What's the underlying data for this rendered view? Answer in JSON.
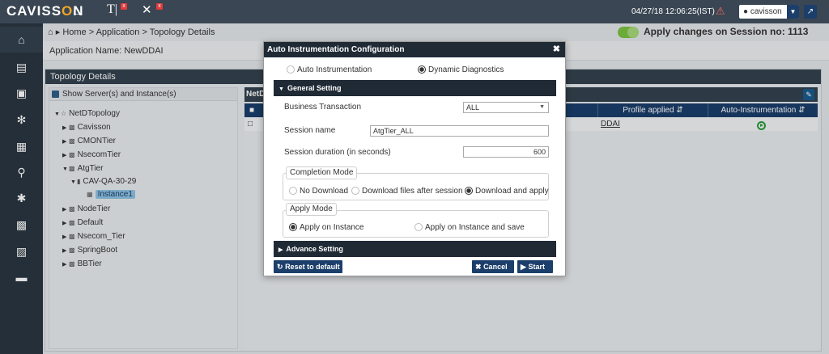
{
  "topbar": {
    "logo_left": "CAVISS",
    "logo_accent": "O",
    "logo_right": "N",
    "datetime": "04/27/18 12:06:25(IST)",
    "user": "cavisson",
    "colors": {
      "bar": "#3a4653",
      "accent": "#f5a623",
      "button": "#1b3e6b"
    }
  },
  "breadcrumb": {
    "text": "Home > Application > Topology Details"
  },
  "apply_changes": {
    "label": "Apply changes on Session no: 1113"
  },
  "app_name": "Application Name: NewDDAI",
  "topology": {
    "header": "Topology Details",
    "show_label": "Show Server(s) and Instance(s)",
    "tree": [
      {
        "label": "NetDTopology"
      },
      {
        "label": "Cavisson"
      },
      {
        "label": "CMONTier"
      },
      {
        "label": "NsecomTier"
      },
      {
        "label": "AtgTier"
      },
      {
        "label": "CAV-QA-30-29"
      },
      {
        "label": "Instance1"
      },
      {
        "label": "NodeTier"
      },
      {
        "label": "Default"
      },
      {
        "label": "Nsecom_Tier"
      },
      {
        "label": "SpringBoot"
      },
      {
        "label": "BBTier"
      }
    ]
  },
  "grid": {
    "title": "NetDT",
    "columns": {
      "profile": "Profile applied",
      "auto": "Auto-Instrumentation"
    },
    "row": {
      "profile": "DDAI"
    }
  },
  "modal": {
    "title": "Auto Instrumentation Configuration",
    "mode_options": [
      "Auto Instrumentation",
      "Dynamic Diagnostics"
    ],
    "general_setting": "General Setting",
    "business_transaction_label": "Business Transaction",
    "business_transaction_value": "ALL",
    "session_name_label": "Session name",
    "session_name_value": "AtgTier_ALL",
    "session_duration_label": "Session duration (in seconds)",
    "session_duration_value": "600",
    "completion_mode": {
      "legend": "Completion Mode",
      "options": [
        "No Download",
        "Download files after session",
        "Download and apply"
      ]
    },
    "apply_mode": {
      "legend": "Apply Mode",
      "options": [
        "Apply on Instance",
        "Apply on Instance and save"
      ]
    },
    "advance_setting": "Advance Setting",
    "reset_label": "Reset to default",
    "cancel_label": "Cancel",
    "start_label": "Start"
  }
}
